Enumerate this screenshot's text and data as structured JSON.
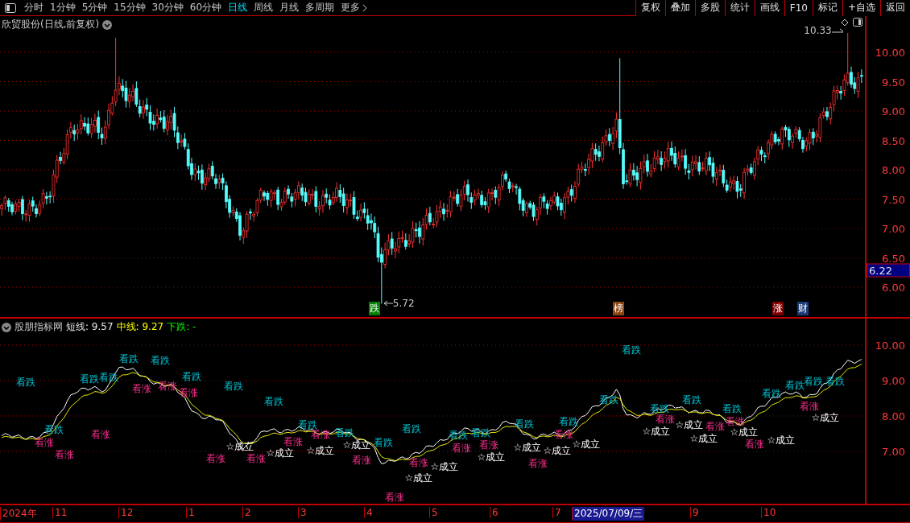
{
  "toolbar": {
    "periods": [
      {
        "label": "分时",
        "selected": false
      },
      {
        "label": "1分钟",
        "selected": false
      },
      {
        "label": "5分钟",
        "selected": false
      },
      {
        "label": "15分钟",
        "selected": false
      },
      {
        "label": "30分钟",
        "selected": false
      },
      {
        "label": "60分钟",
        "selected": false
      },
      {
        "label": "日线",
        "selected": true
      },
      {
        "label": "周线",
        "selected": false
      },
      {
        "label": "月线",
        "selected": false
      },
      {
        "label": "多周期",
        "selected": false
      },
      {
        "label": "更多",
        "selected": false
      }
    ],
    "buttons": [
      "复权",
      "叠加",
      "多股",
      "统计",
      "画线",
      "F10",
      "标记",
      "+自选",
      "返回"
    ]
  },
  "price_panel": {
    "title": "欣贸股份(日线,前复权)",
    "yticks": [
      "10.00",
      "9.50",
      "9.00",
      "8.50",
      "8.00",
      "7.50",
      "7.00",
      "6.50",
      "6.00"
    ],
    "last_price": "6.22",
    "high_label": "10.33",
    "low_label": "5.72",
    "badges": [
      {
        "text": "跌",
        "color": "#008000"
      },
      {
        "text": "榜",
        "color": "#8b4513"
      },
      {
        "text": "涨",
        "color": "#800000"
      },
      {
        "text": "财",
        "color": "#1a3a7a"
      }
    ]
  },
  "indicator_panel": {
    "name": "股朋指标网",
    "values": [
      {
        "kind": "short",
        "label": "短线: 9.57"
      },
      {
        "kind": "mid",
        "label": "中线: 9.27"
      },
      {
        "kind": "down",
        "label": "下跌: -"
      }
    ],
    "yticks": [
      "10.00",
      "9.00",
      "8.00",
      "7.00"
    ],
    "signals": [
      {
        "kind": "sell",
        "text": "看跌"
      },
      {
        "kind": "sell",
        "text": "看跌"
      },
      {
        "kind": "sell",
        "text": "看跌"
      },
      {
        "kind": "sell",
        "text": "看跌"
      },
      {
        "kind": "sell",
        "text": "看跌"
      },
      {
        "kind": "sell",
        "text": "看跌"
      },
      {
        "kind": "sell",
        "text": "看跌"
      },
      {
        "kind": "sell",
        "text": "看跌"
      },
      {
        "kind": "sell",
        "text": "看跌"
      },
      {
        "kind": "sell",
        "text": "看跌"
      },
      {
        "kind": "sell",
        "text": "看跌"
      },
      {
        "kind": "sell",
        "text": "看跌"
      },
      {
        "kind": "sell",
        "text": "看跌"
      },
      {
        "kind": "sell",
        "text": "看跌"
      },
      {
        "kind": "sell",
        "text": "看跌"
      },
      {
        "kind": "sell",
        "text": "看跌"
      },
      {
        "kind": "sell",
        "text": "看跌"
      },
      {
        "kind": "sell",
        "text": "看跌"
      },
      {
        "kind": "sell",
        "text": "看跌"
      },
      {
        "kind": "sell",
        "text": "看跌"
      },
      {
        "kind": "sell",
        "text": "看跌"
      },
      {
        "kind": "sell",
        "text": "看跌"
      },
      {
        "kind": "sell",
        "text": "看跌"
      },
      {
        "kind": "sell",
        "text": "看跌"
      },
      {
        "kind": "sell",
        "text": "看跌"
      },
      {
        "kind": "sell",
        "text": "看跌"
      },
      {
        "kind": "buy",
        "text": "看涨"
      },
      {
        "kind": "buy",
        "text": "看涨"
      },
      {
        "kind": "buy",
        "text": "看涨"
      },
      {
        "kind": "buy",
        "text": "看涨"
      },
      {
        "kind": "buy",
        "text": "看涨"
      },
      {
        "kind": "buy",
        "text": "看涨"
      },
      {
        "kind": "buy",
        "text": "看涨"
      },
      {
        "kind": "buy",
        "text": "看涨"
      },
      {
        "kind": "buy",
        "text": "看涨"
      },
      {
        "kind": "buy",
        "text": "看涨"
      },
      {
        "kind": "buy",
        "text": "看涨"
      },
      {
        "kind": "buy",
        "text": "看涨"
      },
      {
        "kind": "buy",
        "text": "看涨"
      },
      {
        "kind": "buy",
        "text": "看涨"
      },
      {
        "kind": "buy",
        "text": "看涨"
      },
      {
        "kind": "buy",
        "text": "看涨"
      },
      {
        "kind": "buy",
        "text": "看涨"
      },
      {
        "kind": "buy",
        "text": "看涨"
      },
      {
        "kind": "buy",
        "text": "看涨"
      },
      {
        "kind": "buy",
        "text": "看涨"
      },
      {
        "kind": "buy",
        "text": "看涨"
      },
      {
        "kind": "buy",
        "text": "看涨"
      },
      {
        "kind": "confirm",
        "text": "☆成立"
      },
      {
        "kind": "confirm",
        "text": "☆成立"
      },
      {
        "kind": "confirm",
        "text": "☆成立"
      },
      {
        "kind": "confirm",
        "text": "☆成立"
      },
      {
        "kind": "confirm",
        "text": "☆成立"
      },
      {
        "kind": "confirm",
        "text": "☆成立"
      },
      {
        "kind": "confirm",
        "text": "☆成立"
      },
      {
        "kind": "confirm",
        "text": "☆成立"
      },
      {
        "kind": "confirm",
        "text": "☆成立"
      },
      {
        "kind": "confirm",
        "text": "☆成立"
      },
      {
        "kind": "confirm",
        "text": "☆成立"
      },
      {
        "kind": "confirm",
        "text": "☆成立"
      },
      {
        "kind": "confirm",
        "text": "☆成立"
      },
      {
        "kind": "confirm",
        "text": "☆成立"
      },
      {
        "kind": "confirm",
        "text": "☆成立"
      },
      {
        "kind": "confirm",
        "text": "☆成立"
      }
    ]
  },
  "date_axis": [
    {
      "label": "2024年",
      "selected": false
    },
    {
      "label": "11",
      "selected": false
    },
    {
      "label": "12",
      "selected": false
    },
    {
      "label": "1",
      "selected": false
    },
    {
      "label": "2",
      "selected": false
    },
    {
      "label": "3",
      "selected": false
    },
    {
      "label": "4",
      "selected": false
    },
    {
      "label": "5",
      "selected": false
    },
    {
      "label": "6",
      "selected": false
    },
    {
      "label": "7",
      "selected": false
    },
    {
      "label": "2025/07/09/三",
      "selected": true
    },
    {
      "label": "9",
      "selected": false
    },
    {
      "label": "10",
      "selected": false
    }
  ]
}
